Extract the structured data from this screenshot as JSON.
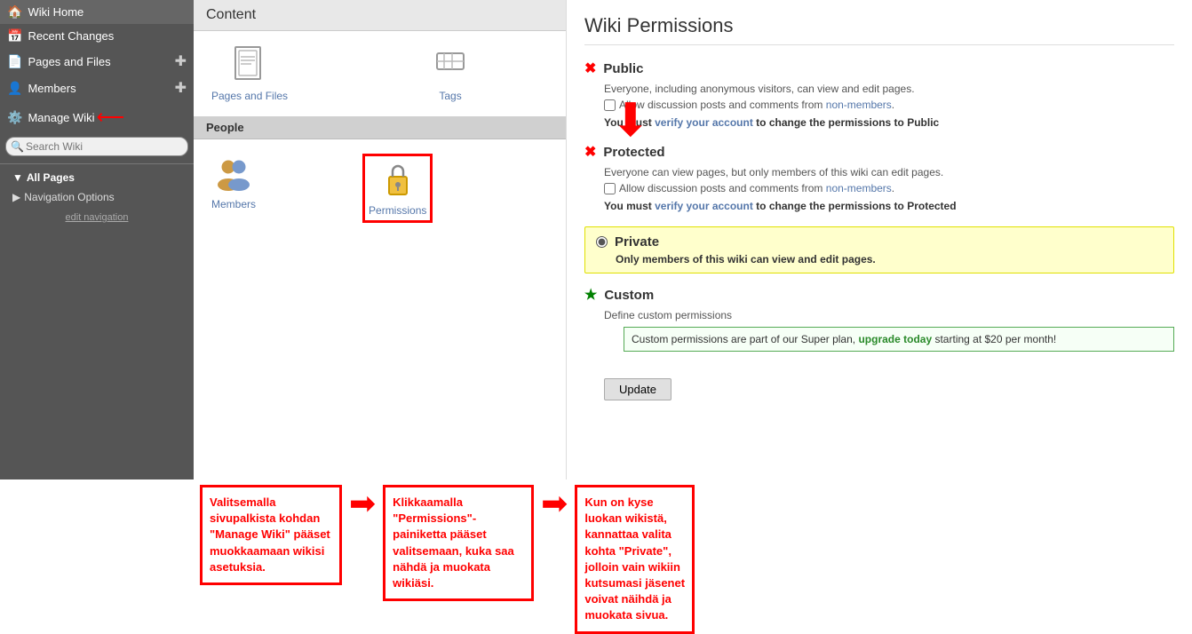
{
  "sidebar": {
    "items": [
      {
        "id": "wiki-home",
        "label": "Wiki Home",
        "icon": "🏠"
      },
      {
        "id": "recent-changes",
        "label": "Recent Changes",
        "icon": "📅"
      },
      {
        "id": "pages-and-files",
        "label": "Pages and Files",
        "icon": "📄",
        "has_add": true
      },
      {
        "id": "members",
        "label": "Members",
        "icon": "👤",
        "has_add": true
      },
      {
        "id": "manage-wiki",
        "label": "Manage Wiki",
        "icon": "⚙️",
        "has_arrow": true
      }
    ],
    "search_placeholder": "Search Wiki",
    "nav_items": [
      {
        "id": "all-pages",
        "label": "All Pages",
        "type": "triangle"
      },
      {
        "id": "navigation-options",
        "label": "Navigation Options",
        "type": "triangle"
      }
    ],
    "edit_nav_label": "edit navigation"
  },
  "content": {
    "header": "Content",
    "icons": [
      {
        "id": "pages-and-files",
        "label": "Pages and Files",
        "icon_char": "📄"
      },
      {
        "id": "tags",
        "label": "Tags",
        "icon_char": "🏷️"
      }
    ],
    "people_header": "People",
    "people_icons": [
      {
        "id": "members",
        "label": "Members",
        "icon_char": "👥"
      },
      {
        "id": "permissions",
        "label": "Permissions",
        "icon_char": "🔒"
      }
    ]
  },
  "permissions": {
    "title": "Wiki Permissions",
    "options": [
      {
        "id": "public",
        "label": "Public",
        "type": "x",
        "desc1": "Everyone, including anonymous visitors, can view and edit pages.",
        "checkbox_label": "Allow discussion posts and comments from non-members.",
        "must_verify": "You must verify your account to change the permissions to Public",
        "verify_link": "verify your account"
      },
      {
        "id": "protected",
        "label": "Protected",
        "type": "x",
        "desc1": "Everyone can view pages, but only members of this wiki can edit pages.",
        "checkbox_label": "Allow discussion posts and comments from non-members.",
        "must_verify": "You must verify your account to change the permissions to Protected",
        "verify_link": "verify your account"
      },
      {
        "id": "private",
        "label": "Private",
        "type": "radio",
        "selected": true,
        "desc1": "Only members of this wiki can view and edit pages."
      },
      {
        "id": "custom",
        "label": "Custom",
        "type": "star",
        "define_label": "Define custom permissions",
        "custom_desc": "Custom permissions are part of our Super plan, ",
        "upgrade_link": "upgrade today",
        "upgrade_suffix": " starting at $20 per month!"
      }
    ],
    "update_button": "Update"
  },
  "annotations": {
    "box1": "Valitsemalla sivupalkista kohdan \"Manage Wiki\" pääset muokkaamaan wikisi asetuksia.",
    "box2": "Klikkaamalla \"Permissions\"-painiketta pääset valitsemaan, kuka saa nähdä ja muokata wikiäsi.",
    "box3": "Kun on kyse luokan wikistä, kannattaa valita kohta \"Private\", jolloin vain wikiin kutsumasi jäsenet voivat näihdä ja muokata sivua."
  }
}
